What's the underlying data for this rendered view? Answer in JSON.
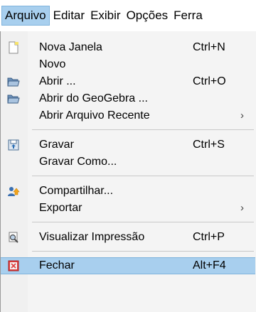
{
  "menubar": {
    "items": [
      "Arquivo",
      "Editar",
      "Exibir",
      "Opções",
      "Ferra"
    ]
  },
  "menu": {
    "nova_janela": {
      "label": "Nova Janela",
      "shortcut": "Ctrl+N",
      "icon": "new-window-icon"
    },
    "novo": {
      "label": "Novo"
    },
    "abrir": {
      "label": "Abrir ...",
      "shortcut": "Ctrl+O",
      "icon": "open-folder-icon"
    },
    "abrir_geogebra": {
      "label": "Abrir do GeoGebra ...",
      "icon": "open-folder-icon"
    },
    "abrir_recente": {
      "label": "Abrir Arquivo Recente",
      "arrow": "›"
    },
    "gravar": {
      "label": "Gravar",
      "shortcut": "Ctrl+S",
      "icon": "save-icon"
    },
    "gravar_como": {
      "label": "Gravar Como..."
    },
    "compartilhar": {
      "label": "Compartilhar...",
      "icon": "share-icon"
    },
    "exportar": {
      "label": "Exportar",
      "arrow": "›"
    },
    "visualizar": {
      "label": "Visualizar Impressão",
      "shortcut": "Ctrl+P",
      "icon": "print-preview-icon"
    },
    "fechar": {
      "label": "Fechar",
      "shortcut": "Alt+F4",
      "icon": "close-icon"
    }
  },
  "colors": {
    "highlight": "#a8cfee",
    "close_icon": "#e04040"
  }
}
